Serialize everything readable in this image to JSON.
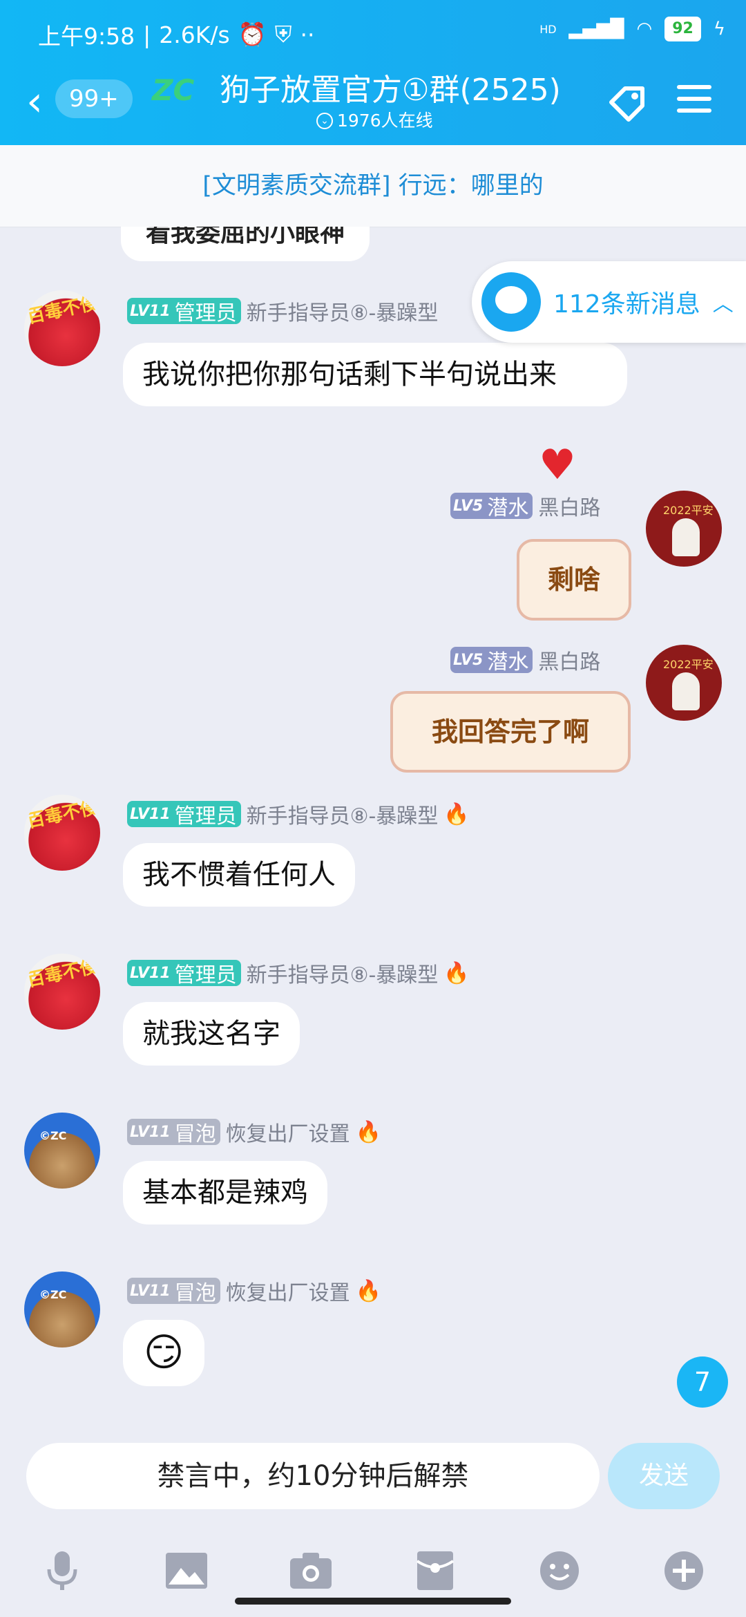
{
  "status_bar": {
    "time": "上午9:58",
    "speed": "2.6K/s",
    "network": "HD",
    "battery": "92"
  },
  "header": {
    "unread_count": "99+",
    "logo_text": "ZC",
    "title": "狗子放置官方①群(2525)",
    "online": "1976人在线"
  },
  "banner": "[文明素质交流群] 行远：哪里的",
  "previous_message": "看我委屈的小眼神",
  "new_messages": "112条新消息",
  "messages": [
    {
      "level": "LV11",
      "title": "管理员",
      "name": "新手指导员⑧-暴躁型",
      "text": "我说你把你那句话剩下半句说出来"
    },
    {
      "level": "LV5",
      "title": "潜水",
      "name": "黑白路",
      "sticker": "剩啥"
    },
    {
      "level": "LV5",
      "title": "潜水",
      "name": "黑白路",
      "sticker": "我回答完了啊"
    },
    {
      "level": "LV11",
      "title": "管理员",
      "name": "新手指导员⑧-暴躁型",
      "text": "我不惯着任何人"
    },
    {
      "level": "LV11",
      "title": "管理员",
      "name": "新手指导员⑧-暴躁型",
      "text": "就我这名字"
    },
    {
      "level": "LV11",
      "title": "冒泡",
      "name": "恢复出厂设置",
      "text": "基本都是辣鸡"
    },
    {
      "level": "LV11",
      "title": "冒泡",
      "name": "恢复出厂设置",
      "text": "😏"
    }
  ],
  "avatar_labels": {
    "red": "百毒不侵",
    "cat": "©ZC",
    "new_year": "2022平安"
  },
  "unseen_count": "7",
  "input": {
    "placeholder": "禁言中，约10分钟后解禁",
    "send": "发送"
  },
  "icons": [
    "mic-icon",
    "image-icon",
    "camera-icon",
    "red-packet-icon",
    "emoji-icon",
    "plus-icon"
  ],
  "colors": {
    "brand": "#12b7f5",
    "admin_badge": "#35c6b9",
    "diver_badge": "#8b95c6",
    "chat_bg": "#ebedf5"
  }
}
